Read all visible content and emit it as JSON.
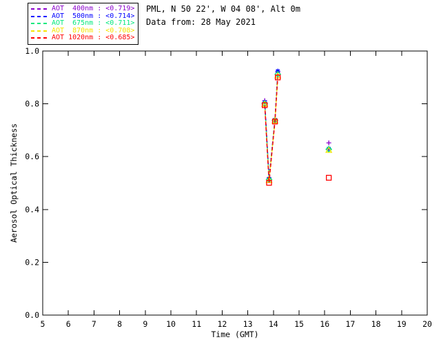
{
  "header": {
    "station": "PML, N 50 22', W 04 08', Alt 0m",
    "date_line": "Data from: 28 May 2021"
  },
  "chart_data": {
    "type": "line",
    "title": "",
    "xlabel": "Time (GMT)",
    "ylabel": "Aerosol Optical Thickness",
    "xlim": [
      5,
      20
    ],
    "ylim": [
      0.0,
      1.0
    ],
    "xticks": [
      5,
      6,
      7,
      8,
      9,
      10,
      11,
      12,
      13,
      14,
      15,
      16,
      17,
      18,
      19,
      20
    ],
    "ytick_labels": [
      "0.0",
      "0.2",
      "0.4",
      "0.6",
      "0.8",
      "1.0"
    ],
    "grid": false,
    "line_style": "dashed",
    "legend_position": "top-left-outside",
    "series": [
      {
        "name": "AOT 400nm",
        "legend_label": "AOT  400nm : <0.719>",
        "mean_value": "<0.719>",
        "color": "#8A00CC",
        "marker": "plus",
        "segments": [
          {
            "x": [
              13.66,
              13.83,
              14.06,
              14.17
            ],
            "y": [
              0.812,
              0.52,
              0.742,
              0.92
            ]
          },
          {
            "x": [
              16.16
            ],
            "y": [
              0.652
            ]
          }
        ]
      },
      {
        "name": "AOT 500nm",
        "legend_label": "AOT  500nm : <0.714>",
        "mean_value": "<0.714>",
        "color": "#0000FF",
        "marker": "asterisk",
        "segments": [
          {
            "x": [
              13.66,
              13.83,
              14.06,
              14.17
            ],
            "y": [
              0.806,
              0.516,
              0.739,
              0.924
            ]
          },
          {
            "x": [
              16.16
            ],
            "y": [
              0.63
            ]
          }
        ]
      },
      {
        "name": "AOT 675nm",
        "legend_label": "AOT  675nm : <0.711>",
        "mean_value": "<0.711>",
        "color": "#00E87C",
        "marker": "diamond",
        "segments": [
          {
            "x": [
              13.66,
              13.83,
              14.06,
              14.17
            ],
            "y": [
              0.801,
              0.513,
              0.737,
              0.912
            ]
          },
          {
            "x": [
              16.16
            ],
            "y": [
              0.628
            ]
          }
        ]
      },
      {
        "name": "AOT 870nm",
        "legend_label": "AOT  870nm : <0.708>",
        "mean_value": "<0.708>",
        "color": "#F5E400",
        "marker": "triangle",
        "segments": [
          {
            "x": [
              13.66,
              13.83,
              14.06,
              14.17
            ],
            "y": [
              0.798,
              0.51,
              0.735,
              0.906
            ]
          },
          {
            "x": [
              16.16
            ],
            "y": [
              0.624
            ]
          }
        ]
      },
      {
        "name": "AOT 1020nm",
        "legend_label": "AOT 1020nm : <0.685>",
        "mean_value": "<0.685>",
        "color": "#FF0000",
        "marker": "square",
        "segments": [
          {
            "x": [
              13.66,
              13.83,
              14.06,
              14.17
            ],
            "y": [
              0.795,
              0.501,
              0.733,
              0.9
            ]
          },
          {
            "x": [
              16.16
            ],
            "y": [
              0.52
            ]
          }
        ]
      }
    ]
  }
}
